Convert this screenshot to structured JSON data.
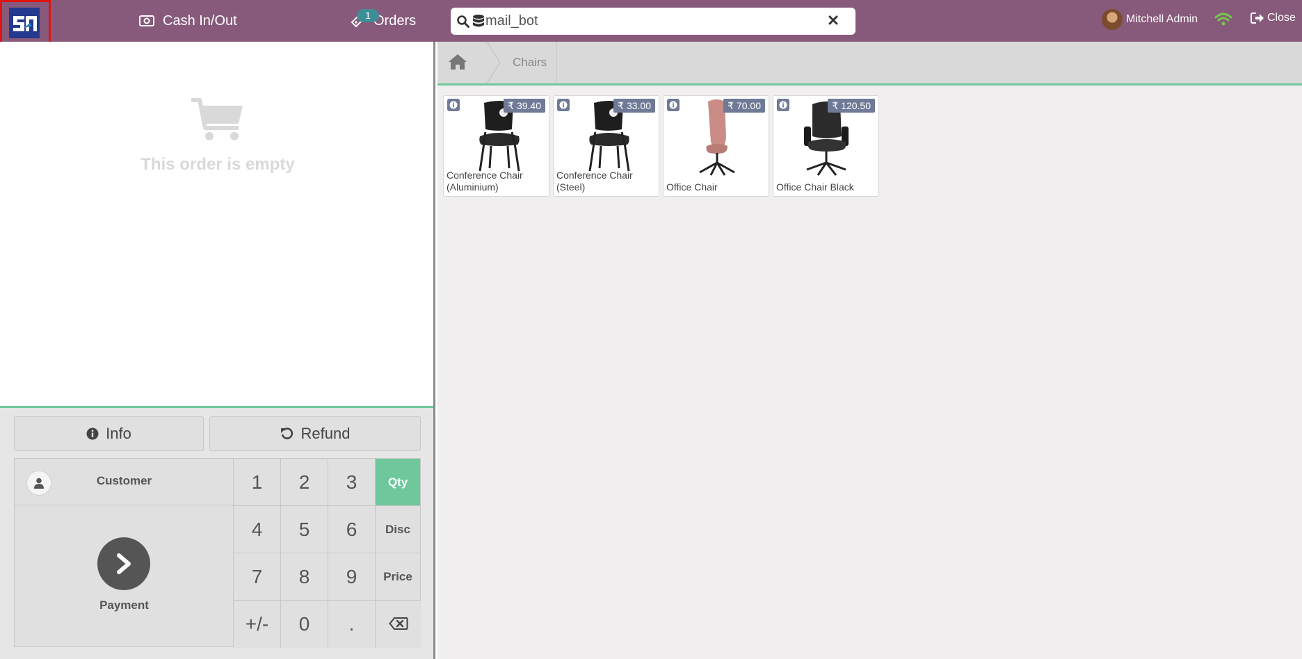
{
  "header": {
    "cash_label": "Cash In/Out",
    "orders_label": "Orders",
    "orders_badge": "1",
    "search_value": "mail_bot",
    "user_name": "Mitchell Admin",
    "close_label": "Close"
  },
  "order": {
    "empty_text": "This order is empty"
  },
  "controls": {
    "info_label": "Info",
    "refund_label": "Refund",
    "customer_label": "Customer",
    "payment_label": "Payment",
    "keys": [
      "1",
      "2",
      "3",
      "Qty",
      "4",
      "5",
      "6",
      "Disc",
      "7",
      "8",
      "9",
      "Price",
      "+/-",
      "0",
      "."
    ],
    "active_mode": "Qty"
  },
  "breadcrumb": {
    "category": "Chairs"
  },
  "products": [
    {
      "name": "Conference Chair (Aluminium)",
      "price": "₹ 39.40"
    },
    {
      "name": "Conference Chair (Steel)",
      "price": "₹ 33.00"
    },
    {
      "name": "Office Chair",
      "price": "₹ 70.00"
    },
    {
      "name": "Office Chair Black",
      "price": "₹ 120.50"
    }
  ],
  "colors": {
    "header": "#875a7b",
    "accent": "#6ec89b",
    "price_badge": "#6f7a96",
    "wifi": "#78c84a"
  }
}
